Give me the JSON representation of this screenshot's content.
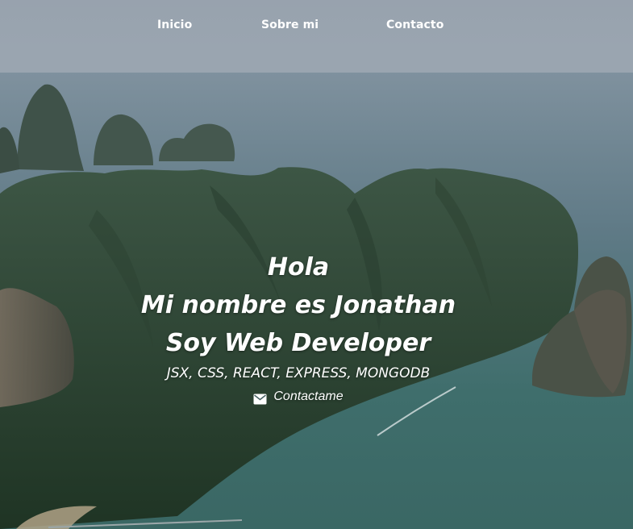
{
  "nav": {
    "items": [
      {
        "label": "Inicio"
      },
      {
        "label": "Sobre mi"
      },
      {
        "label": "Contacto"
      }
    ]
  },
  "hero": {
    "greeting": "Hola",
    "name_line": "Mi nombre es Jonathan",
    "role_line": "Soy Web Developer",
    "stack_line": "JSX, CSS, REACT, EXPRESS, MONGODB",
    "contact_label": "Contactame",
    "contact_icon": "mail-icon"
  },
  "colors": {
    "text": "#ffffff",
    "sky": "#9aa6b1",
    "sea": "#4b706f"
  }
}
